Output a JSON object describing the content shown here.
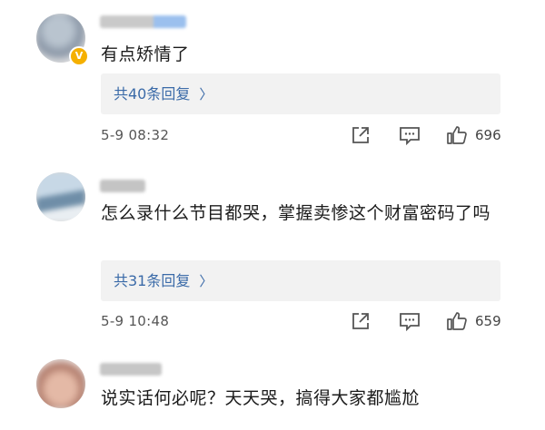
{
  "comments": [
    {
      "text": "有点矫情了",
      "verified": true,
      "replies_label": "共40条回复",
      "timestamp": "5-9 08:32",
      "likes": "696"
    },
    {
      "text": "怎么录什么节目都哭，掌握卖惨这个财富密码了吗",
      "verified": false,
      "replies_label": "共31条回复",
      "timestamp": "5-9 10:48",
      "likes": "659"
    },
    {
      "text": "说实话何必呢？天天哭，搞得大家都尴尬",
      "verified": false
    }
  ],
  "icons": {
    "share": "share-icon",
    "comment": "comment-icon",
    "like": "thumbs-up-icon",
    "reply_arrow": "chevron-right-icon",
    "verified": "verified-badge-icon"
  },
  "colors": {
    "reply_link": "#3a6aa8",
    "reply_box": "#f2f2f2",
    "verified_badge": "#f5b000",
    "meta_text": "#555555"
  }
}
